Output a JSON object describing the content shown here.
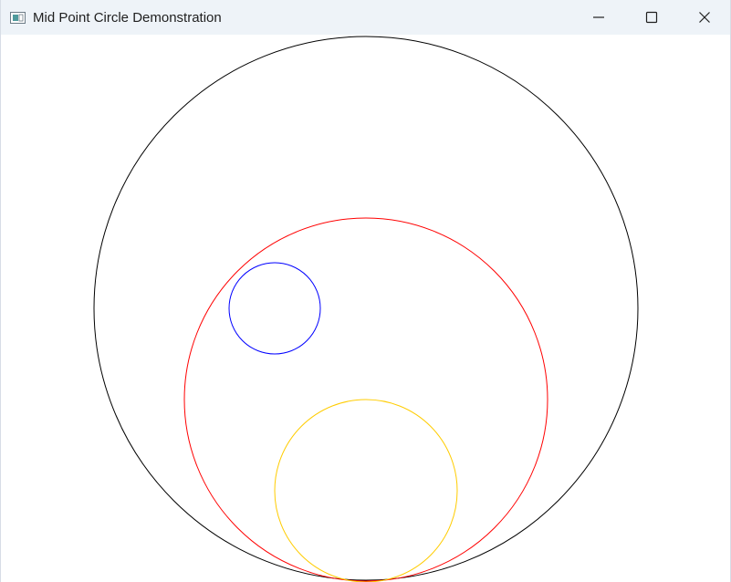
{
  "window": {
    "title": "Mid Point Circle Demonstration",
    "icon": "app-window-icon",
    "controls": {
      "minimize": "minimize-icon",
      "maximize": "maximize-icon",
      "close": "close-icon"
    }
  },
  "colors": {
    "titlebar": "#eef3f8",
    "background": "#ffffff",
    "outer_circle": "#000000",
    "large_inner_circle": "#ff0000",
    "small_circle": "#0000ff",
    "bottom_circle": "#ffcc00"
  }
}
